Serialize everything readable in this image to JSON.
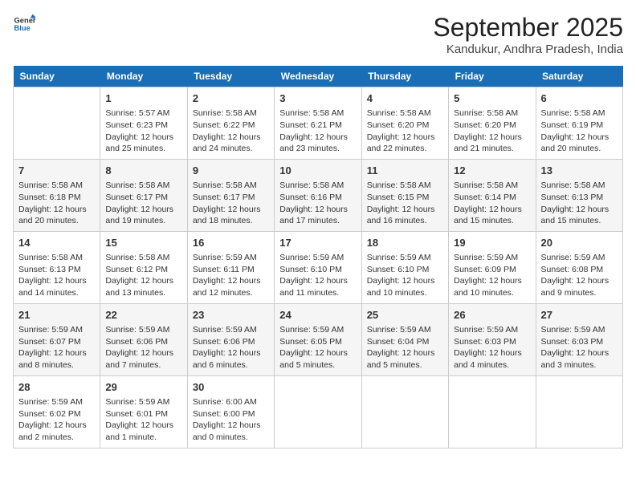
{
  "header": {
    "logo_line1": "General",
    "logo_line2": "Blue",
    "title": "September 2025",
    "subtitle": "Kandukur, Andhra Pradesh, India"
  },
  "days_of_week": [
    "Sunday",
    "Monday",
    "Tuesday",
    "Wednesday",
    "Thursday",
    "Friday",
    "Saturday"
  ],
  "weeks": [
    [
      {
        "day": "",
        "info": ""
      },
      {
        "day": "1",
        "info": "Sunrise: 5:57 AM\nSunset: 6:23 PM\nDaylight: 12 hours\nand 25 minutes."
      },
      {
        "day": "2",
        "info": "Sunrise: 5:58 AM\nSunset: 6:22 PM\nDaylight: 12 hours\nand 24 minutes."
      },
      {
        "day": "3",
        "info": "Sunrise: 5:58 AM\nSunset: 6:21 PM\nDaylight: 12 hours\nand 23 minutes."
      },
      {
        "day": "4",
        "info": "Sunrise: 5:58 AM\nSunset: 6:20 PM\nDaylight: 12 hours\nand 22 minutes."
      },
      {
        "day": "5",
        "info": "Sunrise: 5:58 AM\nSunset: 6:20 PM\nDaylight: 12 hours\nand 21 minutes."
      },
      {
        "day": "6",
        "info": "Sunrise: 5:58 AM\nSunset: 6:19 PM\nDaylight: 12 hours\nand 20 minutes."
      }
    ],
    [
      {
        "day": "7",
        "info": "Sunrise: 5:58 AM\nSunset: 6:18 PM\nDaylight: 12 hours\nand 20 minutes."
      },
      {
        "day": "8",
        "info": "Sunrise: 5:58 AM\nSunset: 6:17 PM\nDaylight: 12 hours\nand 19 minutes."
      },
      {
        "day": "9",
        "info": "Sunrise: 5:58 AM\nSunset: 6:17 PM\nDaylight: 12 hours\nand 18 minutes."
      },
      {
        "day": "10",
        "info": "Sunrise: 5:58 AM\nSunset: 6:16 PM\nDaylight: 12 hours\nand 17 minutes."
      },
      {
        "day": "11",
        "info": "Sunrise: 5:58 AM\nSunset: 6:15 PM\nDaylight: 12 hours\nand 16 minutes."
      },
      {
        "day": "12",
        "info": "Sunrise: 5:58 AM\nSunset: 6:14 PM\nDaylight: 12 hours\nand 15 minutes."
      },
      {
        "day": "13",
        "info": "Sunrise: 5:58 AM\nSunset: 6:13 PM\nDaylight: 12 hours\nand 15 minutes."
      }
    ],
    [
      {
        "day": "14",
        "info": "Sunrise: 5:58 AM\nSunset: 6:13 PM\nDaylight: 12 hours\nand 14 minutes."
      },
      {
        "day": "15",
        "info": "Sunrise: 5:58 AM\nSunset: 6:12 PM\nDaylight: 12 hours\nand 13 minutes."
      },
      {
        "day": "16",
        "info": "Sunrise: 5:59 AM\nSunset: 6:11 PM\nDaylight: 12 hours\nand 12 minutes."
      },
      {
        "day": "17",
        "info": "Sunrise: 5:59 AM\nSunset: 6:10 PM\nDaylight: 12 hours\nand 11 minutes."
      },
      {
        "day": "18",
        "info": "Sunrise: 5:59 AM\nSunset: 6:10 PM\nDaylight: 12 hours\nand 10 minutes."
      },
      {
        "day": "19",
        "info": "Sunrise: 5:59 AM\nSunset: 6:09 PM\nDaylight: 12 hours\nand 10 minutes."
      },
      {
        "day": "20",
        "info": "Sunrise: 5:59 AM\nSunset: 6:08 PM\nDaylight: 12 hours\nand 9 minutes."
      }
    ],
    [
      {
        "day": "21",
        "info": "Sunrise: 5:59 AM\nSunset: 6:07 PM\nDaylight: 12 hours\nand 8 minutes."
      },
      {
        "day": "22",
        "info": "Sunrise: 5:59 AM\nSunset: 6:06 PM\nDaylight: 12 hours\nand 7 minutes."
      },
      {
        "day": "23",
        "info": "Sunrise: 5:59 AM\nSunset: 6:06 PM\nDaylight: 12 hours\nand 6 minutes."
      },
      {
        "day": "24",
        "info": "Sunrise: 5:59 AM\nSunset: 6:05 PM\nDaylight: 12 hours\nand 5 minutes."
      },
      {
        "day": "25",
        "info": "Sunrise: 5:59 AM\nSunset: 6:04 PM\nDaylight: 12 hours\nand 5 minutes."
      },
      {
        "day": "26",
        "info": "Sunrise: 5:59 AM\nSunset: 6:03 PM\nDaylight: 12 hours\nand 4 minutes."
      },
      {
        "day": "27",
        "info": "Sunrise: 5:59 AM\nSunset: 6:03 PM\nDaylight: 12 hours\nand 3 minutes."
      }
    ],
    [
      {
        "day": "28",
        "info": "Sunrise: 5:59 AM\nSunset: 6:02 PM\nDaylight: 12 hours\nand 2 minutes."
      },
      {
        "day": "29",
        "info": "Sunrise: 5:59 AM\nSunset: 6:01 PM\nDaylight: 12 hours\nand 1 minute."
      },
      {
        "day": "30",
        "info": "Sunrise: 6:00 AM\nSunset: 6:00 PM\nDaylight: 12 hours\nand 0 minutes."
      },
      {
        "day": "",
        "info": ""
      },
      {
        "day": "",
        "info": ""
      },
      {
        "day": "",
        "info": ""
      },
      {
        "day": "",
        "info": ""
      }
    ]
  ]
}
